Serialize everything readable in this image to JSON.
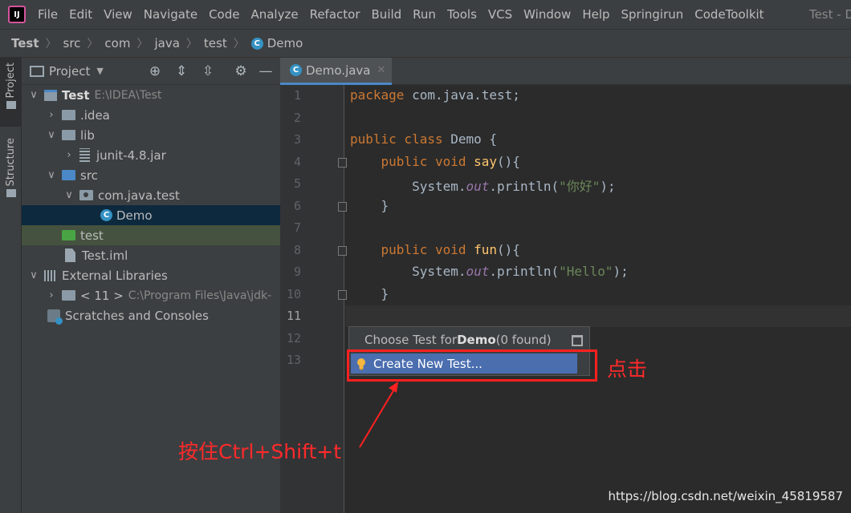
{
  "menu": {
    "items": [
      "File",
      "Edit",
      "View",
      "Navigate",
      "Code",
      "Analyze",
      "Refactor",
      "Build",
      "Run",
      "Tools",
      "VCS",
      "Window",
      "Help",
      "Springirun",
      "CodeToolkit"
    ],
    "window_title": "Test - D",
    "logo_text": "IJ"
  },
  "breadcrumb": [
    "Test",
    "src",
    "com",
    "java",
    "test",
    "Demo"
  ],
  "tool_stripe": {
    "project": "Project",
    "structure": "Structure"
  },
  "project_panel": {
    "title": "Project",
    "tree": [
      {
        "label": "Test",
        "extra": "E:\\IDEA\\Test"
      },
      {
        "label": ".idea"
      },
      {
        "label": "lib"
      },
      {
        "label": "junit-4.8.jar"
      },
      {
        "label": "src"
      },
      {
        "label": "com.java.test"
      },
      {
        "label": "Demo"
      },
      {
        "label": "test"
      },
      {
        "label": "Test.iml"
      },
      {
        "label": "External Libraries"
      },
      {
        "label": "< 11 >",
        "extra": "C:\\Program Files\\Java\\jdk-"
      },
      {
        "label": "Scratches and Consoles"
      }
    ]
  },
  "editor": {
    "tab": "Demo.java",
    "line_numbers": [
      "1",
      "2",
      "3",
      "4",
      "5",
      "6",
      "7",
      "8",
      "9",
      "10",
      "11",
      "12",
      "13"
    ],
    "current_line": 11,
    "code": {
      "l1_kw": "package",
      "l1_rest": " com.java.test;",
      "l3_kw": "public class",
      "l3_name": " Demo",
      "l3_rest": " {",
      "l4_kw": "    public void",
      "l4_fn": " say",
      "l4_rest": "(){",
      "l5_a": "        System.",
      "l5_field": "out",
      "l5_b": ".println(",
      "l5_str": "\"你好\"",
      "l5_c": ");",
      "l6": "    }",
      "l8_kw": "    public void",
      "l8_fn": " fun",
      "l8_rest": "(){",
      "l9_a": "        System.",
      "l9_field": "out",
      "l9_b": ".println(",
      "l9_str": "\"Hello\"",
      "l9_c": ");",
      "l10": "    }"
    }
  },
  "popup": {
    "header_prefix": "Choose Test for ",
    "header_class": "Demo",
    "header_suffix": " (0 found)",
    "action": "Create New Test..."
  },
  "annotations": {
    "click": "点击",
    "hold": "按住Ctrl+Shift+t"
  },
  "watermark": "https://blog.csdn.net/weixin_45819587",
  "colors": {
    "accent": "#4b6eaf",
    "annotation": "#ff2020",
    "selection": "#0d293e"
  }
}
